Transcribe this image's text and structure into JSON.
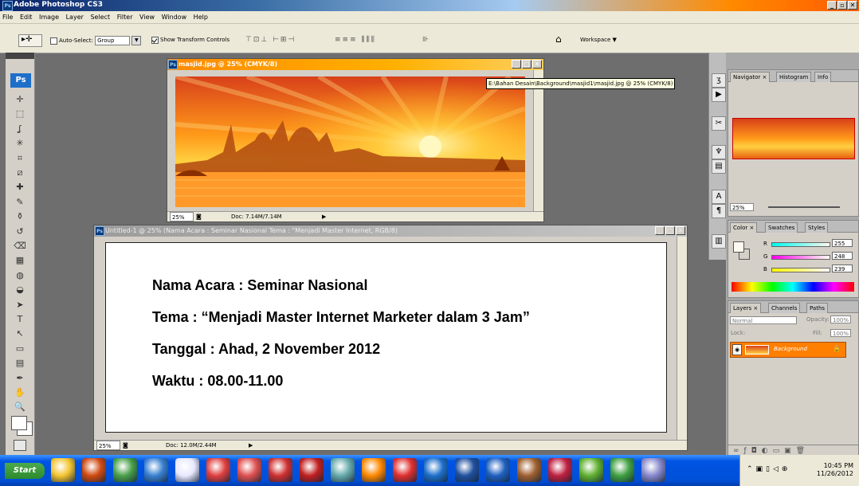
{
  "app": {
    "title": "Adobe Photoshop CS3",
    "badge": "Ps"
  },
  "menu": [
    "File",
    "Edit",
    "Image",
    "Layer",
    "Select",
    "Filter",
    "View",
    "Window",
    "Help"
  ],
  "options": {
    "auto_select_label": "Auto-Select:",
    "auto_select_checked": false,
    "group_value": "Group",
    "show_transform_label": "Show Transform Controls",
    "show_transform_checked": true,
    "workspace_label": "Workspace ▼"
  },
  "tools": {
    "logo": "Ps",
    "icons": [
      "move-icon",
      "marquee-icon",
      "lasso-icon",
      "magic-wand-icon",
      "crop-icon",
      "slice-icon",
      "spot-heal-icon",
      "brush-icon",
      "clone-stamp-icon",
      "history-brush-icon",
      "eraser-icon",
      "gradient-icon",
      "blur-icon",
      "dodge-icon",
      "path-select-icon",
      "type-icon",
      "direct-select-icon",
      "rectangle-icon",
      "notes-icon",
      "eyedropper-icon",
      "hand-icon",
      "zoom-icon"
    ]
  },
  "doc1": {
    "title": "masjid.jpg @ 25% (CMYK/8)",
    "zoom": "25%",
    "doc_size": "Doc: 7.14M/7.14M"
  },
  "tooltip": "E:\\Bahan Desain\\Background\\masjid1\\masjid.jpg @ 25% (CMYK/8)",
  "doc2": {
    "title": "Untitled-1 @ 25% (Nama Acara : Seminar Nasional Tema : \"Menjadi Master Internet, RGB/8)",
    "zoom": "25%",
    "doc_size": "Doc: 12.0M/2.44M",
    "lines": [
      "Nama Acara  : Seminar Nasional",
      "Tema  : “Menjadi Master Internet Marketer dalam 3 Jam”",
      "Tanggal : Ahad, 2 November 2012",
      "Waktu  : 08.00-11.00"
    ]
  },
  "navigator": {
    "tabs": [
      "Navigator ×",
      "Histogram",
      "Info"
    ],
    "zoom": "25%"
  },
  "color": {
    "tabs": [
      "Color ×",
      "Swatches",
      "Styles"
    ],
    "r": "255",
    "g": "248",
    "b": "239",
    "r_label": "R",
    "g_label": "G",
    "b_label": "B"
  },
  "layers": {
    "tabs": [
      "Layers ×",
      "Channels",
      "Paths"
    ],
    "blend": "Normal",
    "opacity_label": "Opacity:",
    "opacity": "100%",
    "lock_label": "Lock:",
    "fill_label": "Fill:",
    "fill": "100%",
    "layer_name": "Background"
  },
  "taskbar": {
    "start": "Start",
    "time": "10:45 PM",
    "date": "11/26/2012"
  },
  "colors": {
    "accent_orange": "#ff8a00",
    "taskbar_blue": "#0054e3",
    "layer_highlight": "#ff7f00"
  }
}
